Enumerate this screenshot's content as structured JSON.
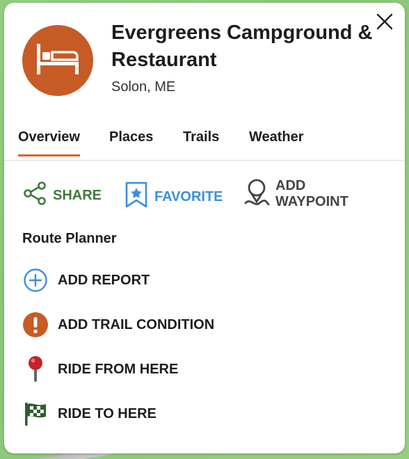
{
  "place": {
    "title": "Evergreens Campground & Restaurant",
    "location": "Solon, ME",
    "icon": "bed-icon"
  },
  "tabs": [
    {
      "label": "Overview",
      "active": true
    },
    {
      "label": "Places"
    },
    {
      "label": "Trails"
    },
    {
      "label": "Weather"
    }
  ],
  "actions": {
    "share": {
      "label": "SHARE",
      "color": "#3d7a3a"
    },
    "favorite": {
      "label": "FAVORITE",
      "color": "#3d8edb"
    },
    "waypoint": {
      "label_line1": "ADD",
      "label_line2": "WAYPOINT",
      "color": "#444444"
    }
  },
  "route_planner": {
    "title": "Route Planner",
    "items": [
      {
        "label": "ADD REPORT",
        "icon": "plus-circle-icon"
      },
      {
        "label": "ADD TRAIL CONDITION",
        "icon": "exclamation-icon"
      },
      {
        "label": "RIDE FROM HERE",
        "icon": "pin-icon"
      },
      {
        "label": "RIDE TO HERE",
        "icon": "checkered-flag-icon"
      }
    ]
  },
  "colors": {
    "accent": "#d9652a",
    "avatar": "#c75b26"
  }
}
